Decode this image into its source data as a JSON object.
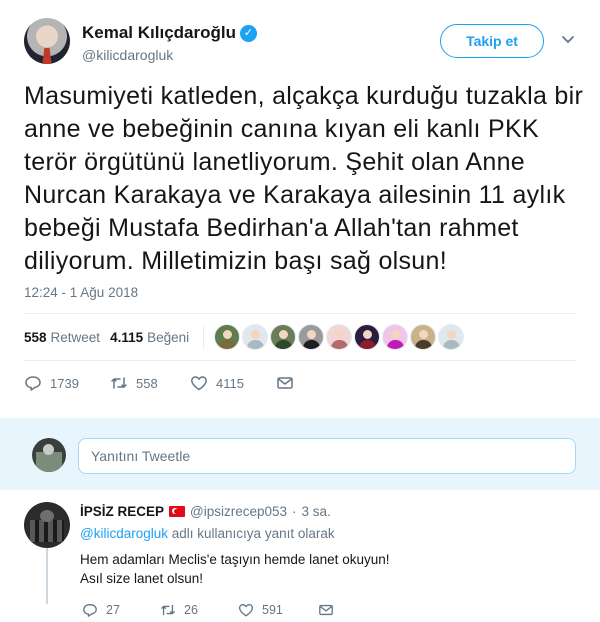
{
  "author": {
    "name": "Kemal Kılıçdaroğlu",
    "handle": "@kilicdarogluk",
    "follow_label": "Takip et"
  },
  "tweet": {
    "text": "Masumiyeti katleden, alçakça kurduğu tuzakla bir anne ve bebeğinin canına kıyan eli kanlı PKK terör örgütünü lanetliyorum. Şehit olan Anne Nurcan Karakaya ve Karakaya ailesinin 11 aylık bebeği Mustafa Bedirhan'a Allah'tan rahmet diliyorum. Milletimizin başı sağ olsun!",
    "timestamp": "12:24 - 1 Ağu 2018"
  },
  "stats": {
    "retweets": "558",
    "retweet_label": "Retweet",
    "likes": "4.115",
    "like_label": "Beğeni"
  },
  "liker_faces": [
    {
      "body": "#7c6a3d",
      "bg": "#5f7d4a"
    },
    {
      "body": "#aab8c2",
      "bg": "#e1e8ed"
    },
    {
      "body": "#2f4a2a",
      "bg": "#6b7c58"
    },
    {
      "body": "#1e1e1e",
      "bg": "#9a9a9a"
    },
    {
      "body": "#b36b6b",
      "bg": "#f0d6d6"
    },
    {
      "body": "#8b1d2c",
      "bg": "#2a1d3f"
    },
    {
      "body": "#c21bb5",
      "bg": "#f3c4ea"
    },
    {
      "body": "#4a3b2a",
      "bg": "#c9b28a"
    },
    {
      "body": "#aab8c2",
      "bg": "#e1e8ed"
    }
  ],
  "actions": {
    "replies": "1739",
    "retweets": "558",
    "likes": "4115"
  },
  "reply_box": {
    "placeholder": "Yanıtını Tweetle"
  },
  "reply": {
    "name": "İPSİZ RECEP",
    "handle": "@ipsizrecep053",
    "separator": "·",
    "time": "3 sa.",
    "reply_to_user": "@kilicdarogluk",
    "reply_to_suffix": "adlı kullanıcıya yanıt olarak",
    "line1": "Hem adamları Meclis'e taşıyın hemde lanet okuyun!",
    "line2": "Asıl size lanet olsun!",
    "replies": "27",
    "retweets": "26",
    "likes": "591"
  },
  "colors": {
    "accent": "#1da1f2",
    "muted": "#657786",
    "reply_bar_bg": "#e8f5fd",
    "flag_red": "#e30a17"
  }
}
